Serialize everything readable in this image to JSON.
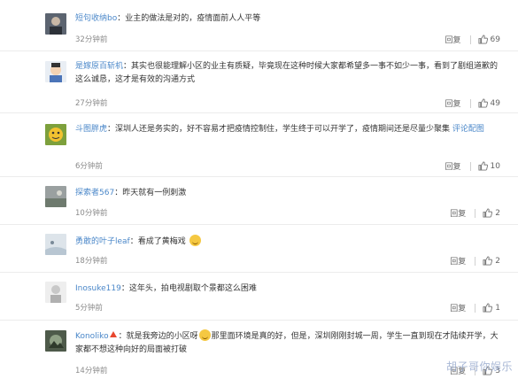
{
  "ui": {
    "reply_label": "回复",
    "like_icon": "thumbs-up-icon",
    "accent_color": "#4a87c9"
  },
  "comments": [
    {
      "user": "短句收纳bo",
      "text": "业主的做法是对的，疫情面前人人平等",
      "time": "32分钟前",
      "likes": "69"
    },
    {
      "user": "是嫁原百斩机",
      "text": "其实也很能理解小区的业主有质疑，毕竟现在这种时候大家都希望多一事不如少一事，看到了剧组道歉的这么诚恳，这才是有效的沟通方式",
      "time": "27分钟前",
      "likes": "49"
    },
    {
      "user": "斗图胖虎",
      "text": "深圳人还是务实的，好不容易才把疫情控制住，学生终于可以开学了，疫情期间还是尽量少聚集",
      "link": "评论配图",
      "time": "6分钟前",
      "likes": "10"
    },
    {
      "user": "探索者567",
      "text": "昨天就有一例刺激",
      "time": "10分钟前",
      "likes": "2"
    },
    {
      "user": "勇敢的叶子leaf",
      "text": "看成了黄梅戏",
      "time": "18分钟前",
      "likes": "2"
    },
    {
      "user": "Inosuke119",
      "text": "这年头，拍电视剧取个景都这么困难",
      "time": "5分钟前",
      "likes": "1"
    },
    {
      "user": "Konoliko",
      "text_a": "就是我旁边的小区呀",
      "text_b": "那里面环境是真的好，但是，深圳刚刚封城一周，学生一直到现在才陆续开学，大家都不想这种向好的局面被打破",
      "time": "14分钟前",
      "likes": "3"
    }
  ],
  "watermark": "胡子哥你娱乐"
}
